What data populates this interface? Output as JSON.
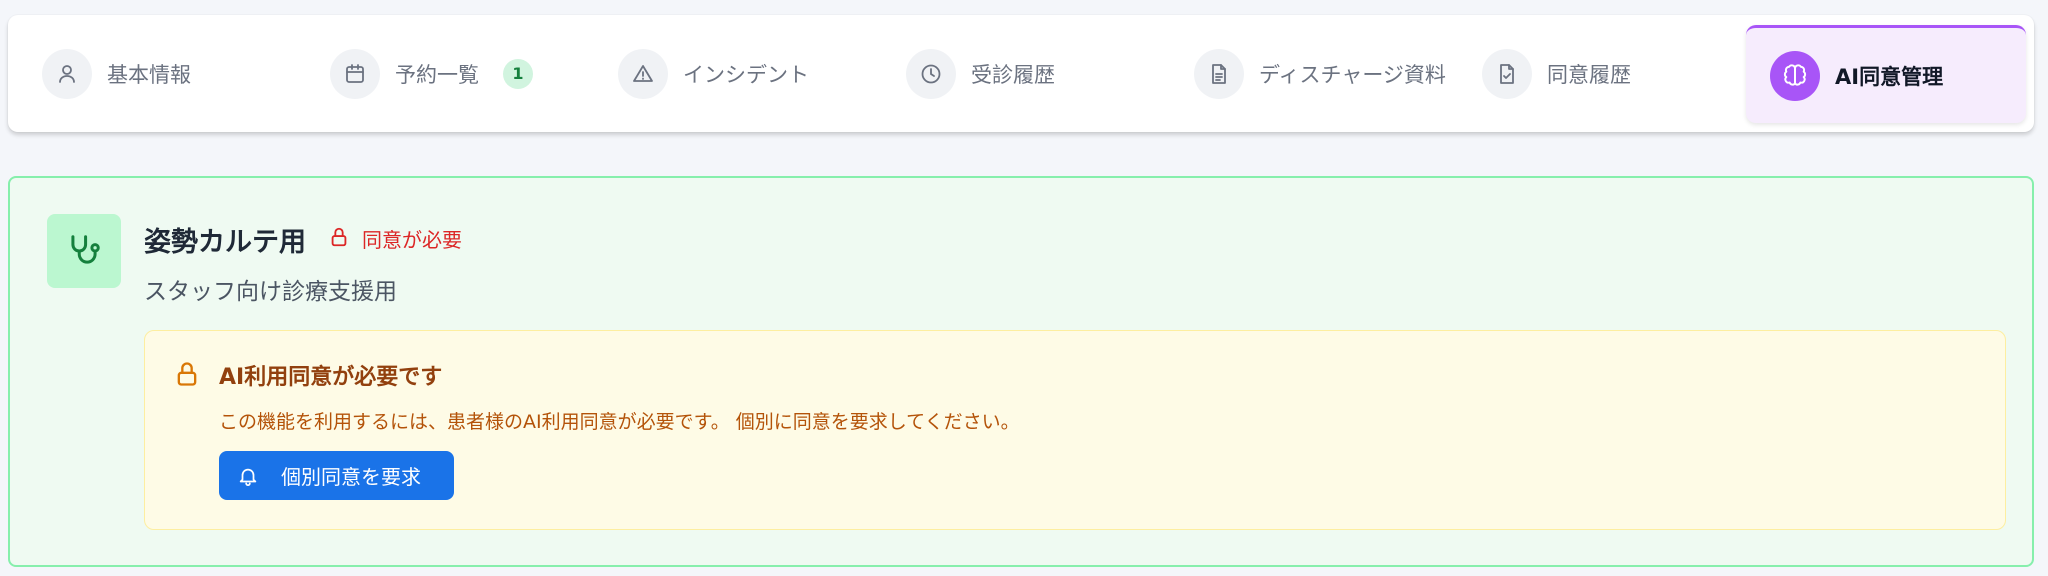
{
  "tabs": [
    {
      "label": "基本情報",
      "icon": "user-icon"
    },
    {
      "label": "予約一覧",
      "icon": "calendar-icon",
      "badge": "1"
    },
    {
      "label": "インシデント",
      "icon": "warning-triangle-icon"
    },
    {
      "label": "受診履歴",
      "icon": "clock-icon"
    },
    {
      "label": "ディスチャージ資料",
      "icon": "document-icon"
    },
    {
      "label": "同意履歴",
      "icon": "document-check-icon"
    },
    {
      "label": "AI同意管理",
      "icon": "brain-icon",
      "active": true
    }
  ],
  "card": {
    "icon": "stethoscope-icon",
    "title": "姿勢カルテ用",
    "requirement": "同意が必要",
    "subtitle": "スタッフ向け診療支援用",
    "notice": {
      "title": "AI利用同意が必要です",
      "message": "この機能を利用するには、患者様のAI利用同意が必要です。 個別に同意を要求してください。",
      "button_label": "個別同意を要求"
    }
  },
  "colors": {
    "accent": "#a855f7",
    "primary_button": "#1a73e8",
    "card_border": "#86efac",
    "warning_text": "#92400e",
    "danger_text": "#dc2626"
  }
}
